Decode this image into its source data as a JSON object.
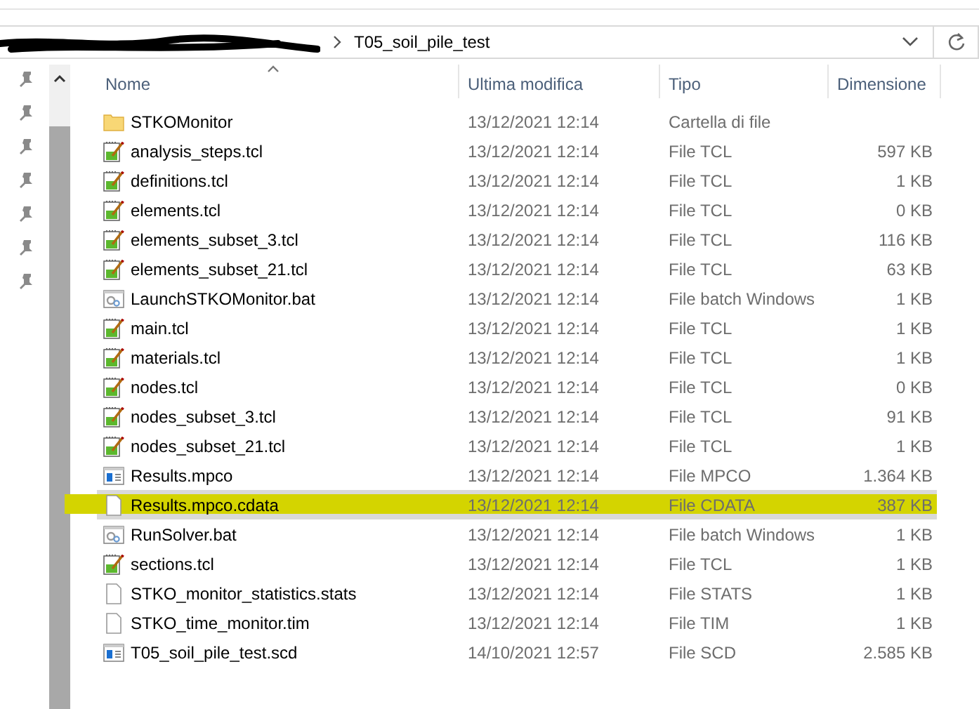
{
  "address_bar": {
    "current_folder": "T05_soil_pile_test"
  },
  "columns": [
    {
      "label": "Nome",
      "sorted": true
    },
    {
      "label": "Ultima modifica",
      "sorted": false
    },
    {
      "label": "Tipo",
      "sorted": false
    },
    {
      "label": "Dimensione",
      "sorted": false
    }
  ],
  "files": [
    {
      "name": "STKOMonitor",
      "modified": "13/12/2021 12:14",
      "type": "Cartella di file",
      "kind": "folder",
      "selected": false,
      "highlighted": false
    },
    {
      "name": "analysis_steps.tcl",
      "modified": "13/12/2021 12:14",
      "type": "File TCL",
      "size": "597 KB",
      "kind": "script",
      "selected": false,
      "highlighted": false
    },
    {
      "name": "definitions.tcl",
      "modified": "13/12/2021 12:14",
      "type": "File TCL",
      "size": "1 KB",
      "kind": "script",
      "selected": false,
      "highlighted": false
    },
    {
      "name": "elements.tcl",
      "modified": "13/12/2021 12:14",
      "type": "File TCL",
      "size": "0 KB",
      "kind": "script",
      "selected": false,
      "highlighted": false
    },
    {
      "name": "elements_subset_3.tcl",
      "modified": "13/12/2021 12:14",
      "type": "File TCL",
      "size": "116 KB",
      "kind": "script",
      "selected": false,
      "highlighted": false
    },
    {
      "name": "elements_subset_21.tcl",
      "modified": "13/12/2021 12:14",
      "type": "File TCL",
      "size": "63 KB",
      "kind": "script",
      "selected": false,
      "highlighted": false
    },
    {
      "name": "LaunchSTKOMonitor.bat",
      "modified": "13/12/2021 12:14",
      "type": "File batch Windows",
      "size": "1 KB",
      "kind": "batch",
      "selected": false,
      "highlighted": false
    },
    {
      "name": "main.tcl",
      "modified": "13/12/2021 12:14",
      "type": "File TCL",
      "size": "1 KB",
      "kind": "script",
      "selected": false,
      "highlighted": false
    },
    {
      "name": "materials.tcl",
      "modified": "13/12/2021 12:14",
      "type": "File TCL",
      "size": "1 KB",
      "kind": "script",
      "selected": false,
      "highlighted": false
    },
    {
      "name": "nodes.tcl",
      "modified": "13/12/2021 12:14",
      "type": "File TCL",
      "size": "0 KB",
      "kind": "script",
      "selected": false,
      "highlighted": false
    },
    {
      "name": "nodes_subset_3.tcl",
      "modified": "13/12/2021 12:14",
      "type": "File TCL",
      "size": "91 KB",
      "kind": "script",
      "selected": false,
      "highlighted": false
    },
    {
      "name": "nodes_subset_21.tcl",
      "modified": "13/12/2021 12:14",
      "type": "File TCL",
      "size": "1 KB",
      "kind": "script",
      "selected": false,
      "highlighted": false
    },
    {
      "name": "Results.mpco",
      "modified": "13/12/2021 12:14",
      "type": "File MPCO",
      "size": "1.364 KB",
      "kind": "app",
      "selected": false,
      "highlighted": false
    },
    {
      "name": "Results.mpco.cdata",
      "modified": "13/12/2021 12:14",
      "type": "File CDATA",
      "size": "387 KB",
      "kind": "blank",
      "selected": true,
      "highlighted": true
    },
    {
      "name": "RunSolver.bat",
      "modified": "13/12/2021 12:14",
      "type": "File batch Windows",
      "size": "1 KB",
      "kind": "batch",
      "selected": false,
      "highlighted": false
    },
    {
      "name": "sections.tcl",
      "modified": "13/12/2021 12:14",
      "type": "File TCL",
      "size": "1 KB",
      "kind": "script",
      "selected": false,
      "highlighted": false
    },
    {
      "name": "STKO_monitor_statistics.stats",
      "modified": "13/12/2021 12:14",
      "type": "File STATS",
      "size": "1 KB",
      "kind": "blank",
      "selected": false,
      "highlighted": false
    },
    {
      "name": "STKO_time_monitor.tim",
      "modified": "13/12/2021 12:14",
      "type": "File TIM",
      "size": "1 KB",
      "kind": "blank",
      "selected": false,
      "highlighted": false
    },
    {
      "name": "T05_soil_pile_test.scd",
      "modified": "14/10/2021 12:57",
      "type": "File SCD",
      "size": "2.585 KB",
      "kind": "app",
      "selected": false,
      "highlighted": false
    }
  ]
}
